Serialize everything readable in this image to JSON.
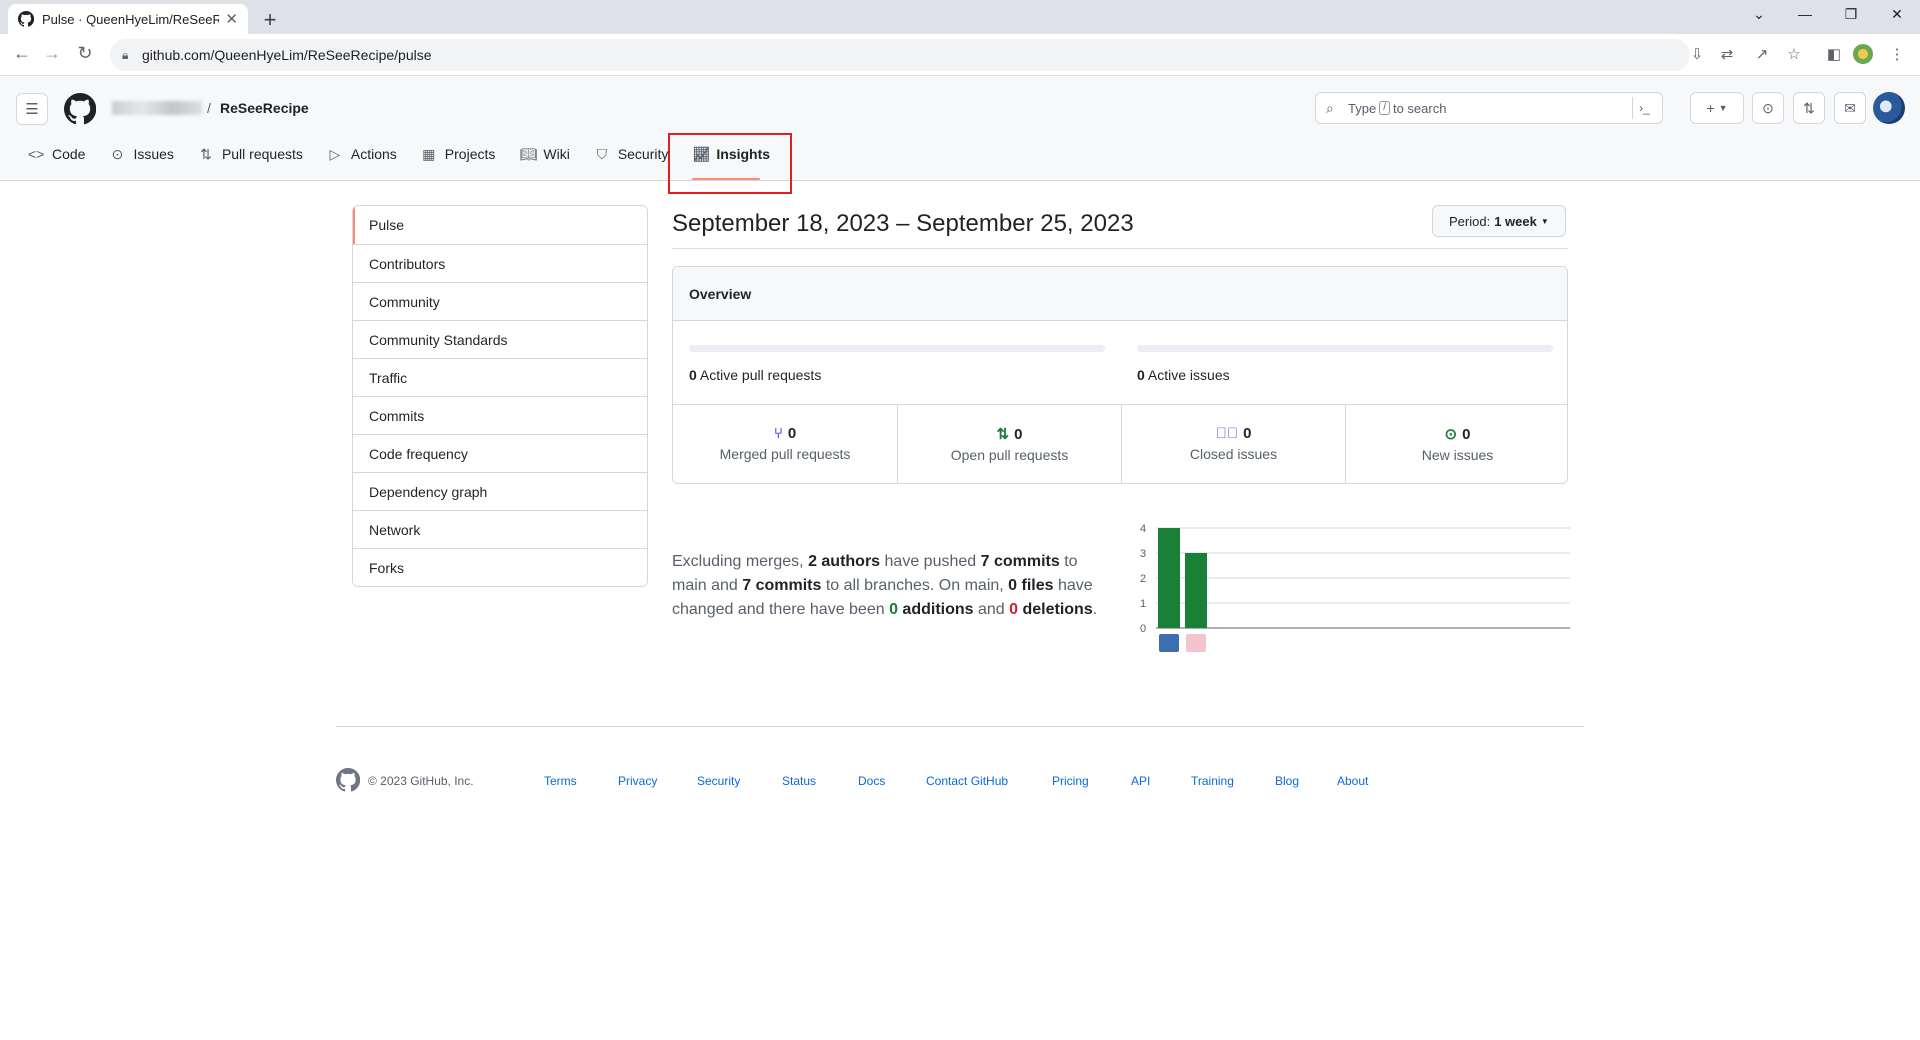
{
  "browser": {
    "tab_title": "Pulse · QueenHyeLim/ReSeeRecipe",
    "url": "github.com/QueenHyeLim/ReSeeRecipe/pulse"
  },
  "header": {
    "repo_name": "ReSeeRecipe",
    "search_prefix": "Type",
    "search_key": "/",
    "search_suffix": "to search"
  },
  "repo_nav": [
    {
      "label": "Code",
      "icon": "code-icon"
    },
    {
      "label": "Issues",
      "icon": "issue-icon"
    },
    {
      "label": "Pull requests",
      "icon": "pull-request-icon"
    },
    {
      "label": "Actions",
      "icon": "play-icon"
    },
    {
      "label": "Projects",
      "icon": "table-icon"
    },
    {
      "label": "Wiki",
      "icon": "book-icon"
    },
    {
      "label": "Security",
      "icon": "shield-icon"
    },
    {
      "label": "Insights",
      "icon": "graph-icon"
    }
  ],
  "sidebar": {
    "items": [
      "Pulse",
      "Contributors",
      "Community",
      "Community Standards",
      "Traffic",
      "Commits",
      "Code frequency",
      "Dependency graph",
      "Network",
      "Forks"
    ]
  },
  "pulse": {
    "date_range": "September 18, 2023 – September 25, 2023",
    "period_label": "Period:",
    "period_value": "1 week",
    "overview_title": "Overview",
    "active_prs_count": "0",
    "active_prs_label": "Active pull requests",
    "active_issues_count": "0",
    "active_issues_label": "Active issues",
    "stats": [
      {
        "count": "0",
        "label": "Merged pull requests",
        "color": "#8250df"
      },
      {
        "count": "0",
        "label": "Open pull requests",
        "color": "#1a7f37"
      },
      {
        "count": "0",
        "label": "Closed issues",
        "color": "#8250df"
      },
      {
        "count": "0",
        "label": "New issues",
        "color": "#1a7f37"
      }
    ],
    "summary": {
      "t1": "Excluding merges, ",
      "authors": "2 authors",
      "t2": " have pushed ",
      "commits_main": "7 commits",
      "t3": " to main and ",
      "commits_all": "7 commits",
      "t4": " to all branches. On main, ",
      "files": "0 files",
      "t5": " have changed and there have been ",
      "additions": "0",
      "additions_word": " additions",
      "t6": " and ",
      "deletions": "0",
      "deletions_word": " deletions",
      "t7": "."
    }
  },
  "chart_data": {
    "type": "bar",
    "categories": [
      "author-1",
      "author-2"
    ],
    "values": [
      4,
      3
    ],
    "ylim": [
      0,
      4
    ],
    "yticks": [
      "0",
      "1",
      "2",
      "3",
      "4"
    ],
    "bar_color": "#1a7f37",
    "grid": true
  },
  "footer": {
    "copyright": "© 2023 GitHub, Inc.",
    "links": [
      "Terms",
      "Privacy",
      "Security",
      "Status",
      "Docs",
      "Contact GitHub",
      "Pricing",
      "API",
      "Training",
      "Blog",
      "About"
    ]
  }
}
